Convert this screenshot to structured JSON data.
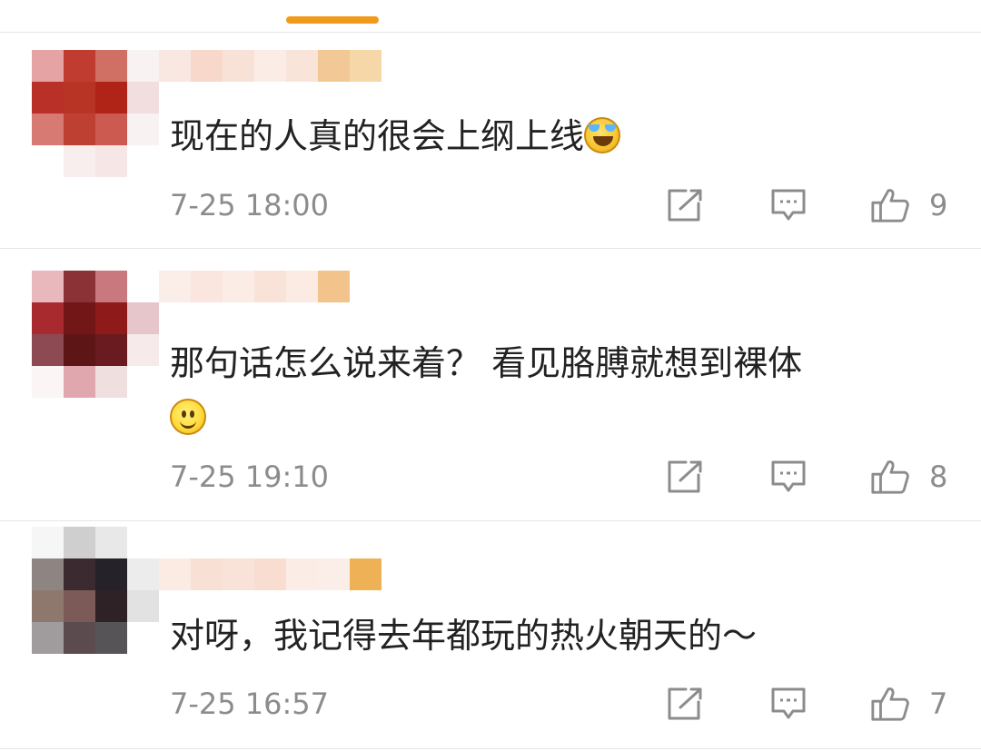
{
  "comments": [
    {
      "text": "现在的人真的很会上纲上线",
      "emoji": "laughing-tears-emoji",
      "time": "7-25 18:00",
      "likes": "9",
      "avatar_colors": [
        "#e5a3a3",
        "#c03b30",
        "#d07065",
        "#f8f2f2",
        "#b83028",
        "#b83525",
        "#b02418",
        "#f2dede",
        "#d77a73",
        "#be4032",
        "#cc5a50",
        "#f8f2f2",
        "#ffffff",
        "#f8eeee",
        "#f6e6e6",
        "#ffffff"
      ],
      "name_colors": [
        "#f9e7e1",
        "#f7d8ca",
        "#f8e2d8",
        "#fbece6",
        "#f9e4da",
        "#f2c996",
        "#f5d7a8"
      ]
    },
    {
      "text": "那句话怎么说来着？ 看见胳膊就想到裸体",
      "emoji": "smile-emoji",
      "time": "7-25 19:10",
      "likes": "8",
      "avatar_colors": [
        "#e9b8bc",
        "#8a3236",
        "#c9787e",
        "#ffffff",
        "#a82a2e",
        "#721618",
        "#8e1a1a",
        "#e6c6ca",
        "#8d4a52",
        "#5e1516",
        "#6a1b1f",
        "#f6eaea",
        "#fbf5f5",
        "#e0a8ae",
        "#f0dfdf",
        "#ffffff"
      ],
      "name_colors": [
        "#fbeee9",
        "#fae6df",
        "#fbece6",
        "#f9e3d9",
        "#fbebe3",
        "#f2c38a"
      ]
    },
    {
      "text": "对呀，我记得去年都玩的热火朝天的～",
      "emoji": "",
      "time": "7-25 16:57",
      "likes": "7",
      "avatar_colors": [
        "#f6f6f6",
        "#cfcfcf",
        "#e8e8e8",
        "#ffffff",
        "#8e8582",
        "#3b2a2f",
        "#25222a",
        "#ececec",
        "#8e786e",
        "#7c5a58",
        "#2e2227",
        "#e2e2e2",
        "#a09b9c",
        "#5c4b4e",
        "#575457",
        "#ffffff"
      ],
      "name_colors": [
        "#fbebe3",
        "#f8e0d5",
        "#f9e3d9",
        "#f8ddd0",
        "#fbece6",
        "#fbeee8",
        "#eeb155"
      ]
    }
  ],
  "icons": {
    "share": "share-icon",
    "reply": "comment-icon",
    "like": "thumbs-up-icon"
  },
  "colors": {
    "accent": "#f19a1c",
    "text": "#222222",
    "meta": "#8c8c8c",
    "icon": "#8c8c8c"
  }
}
